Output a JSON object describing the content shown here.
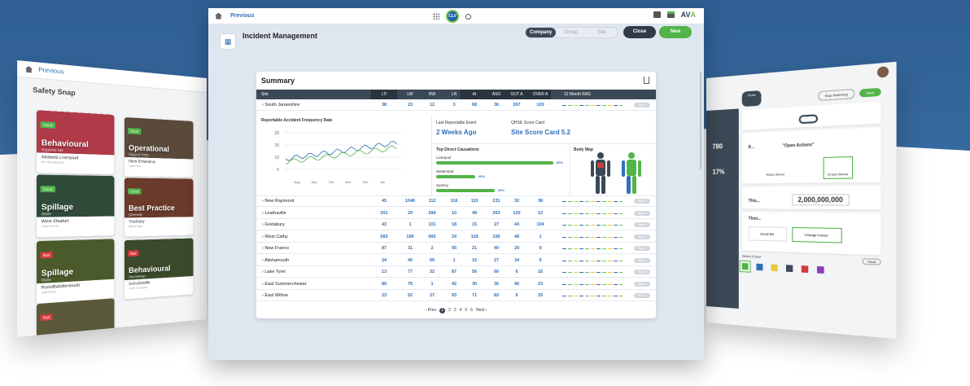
{
  "left_panel": {
    "prev": "Previous",
    "title": "Safety Snap",
    "cards": [
      {
        "tag": "Good",
        "title": "Behavioural",
        "sub": "Organise site",
        "place": "Airaweb Liverpool",
        "meta": "Eric Shaughnessy",
        "color": "#b03a48",
        "tagc": "#52b34a"
      },
      {
        "tag": "Good",
        "title": "Operational",
        "sub": "Support Tools",
        "place": "New Ernestina",
        "meta": "Logan Sixa",
        "color": "#5a4a3a",
        "tagc": "#52b34a"
      },
      {
        "tag": "Good",
        "title": "Spillage",
        "sub": "Water",
        "place": "West Elsafurt",
        "meta": "Fulton Turmul",
        "color": "#2f4a38",
        "tagc": "#52b34a"
      },
      {
        "tag": "Good",
        "title": "Best Practice",
        "sub": "Driveway",
        "place": "Yostbury",
        "meta": "Marcel Rapp",
        "color": "#6a3a2a",
        "tagc": "#52b34a"
      },
      {
        "tag": "Bad",
        "title": "Spillage",
        "sub": "Water",
        "place": "Runolfsdottirmouth",
        "meta": "Leila Mckay",
        "color": "#4a5a2a",
        "tagc": "#d63b3b"
      },
      {
        "tag": "Bad",
        "title": "Behavioural",
        "sub": "Housekeep",
        "place": "Schulistville",
        "meta": "Ulrich Hernandez",
        "color": "#3a4a2a",
        "tagc": "#d63b3b"
      },
      {
        "tag": "Bad",
        "title": "",
        "sub": "",
        "place": "",
        "meta": "",
        "color": "#5a5a3a",
        "tagc": "#d63b3b"
      }
    ]
  },
  "topbar": {
    "previous": "Previous",
    "logo": "CLV",
    "brand_a": "AV",
    "brand_b": "A"
  },
  "page": {
    "title": "Incident Management",
    "seg": [
      "Company",
      "Group",
      "Site"
    ],
    "close": "Close",
    "new": "New"
  },
  "summary": {
    "title": "Summary",
    "headers": [
      "Site",
      "LTI",
      "LW",
      "RW",
      "LR",
      "AI",
      "ASO",
      "OUT A",
      "OVER A",
      "12 Month RAG"
    ],
    "first": {
      "name": "South Janaeshire",
      "vals": [
        "38",
        "23",
        "12",
        "3",
        "68",
        "36",
        "267",
        "103"
      ],
      "report": "Report"
    },
    "chart": {
      "title": "Reportable Accident Frequency Rate",
      "yticks": [
        "20",
        "15",
        "10",
        "5"
      ],
      "xticks": [
        "Aug",
        "Sep",
        "Oct",
        "Nov",
        "Dec",
        "Jan"
      ]
    },
    "last_event_label": "Last Reportable Event",
    "last_event": "2 Weeks Ago",
    "qhse_label": "QHSE Score Card",
    "qhse": "Site Score Card 5.2",
    "causes_label": "Top Direct Causations",
    "causes": [
      {
        "name": "Liverpool",
        "pct": "60%",
        "v": 0.6
      },
      {
        "name": "Walterstad",
        "pct": "20%",
        "v": 0.2
      },
      {
        "name": "Sydney",
        "pct": "30%",
        "v": 0.3
      }
    ],
    "body_map": "Body Map",
    "rows": [
      {
        "name": "New Raymond",
        "vals": [
          "45",
          "1046",
          "112",
          "116",
          "110",
          "231",
          "32",
          "38"
        ]
      },
      {
        "name": "Leathaville",
        "vals": [
          "201",
          "29",
          "284",
          "10",
          "49",
          "263",
          "120",
          "12"
        ]
      },
      {
        "name": "Gretabury",
        "vals": [
          "43",
          "1",
          "101",
          "18",
          "15",
          "27",
          "44",
          "104"
        ]
      },
      {
        "name": "West Cathy",
        "vals": [
          "683",
          "106",
          "965",
          "24",
          "118",
          "106",
          "48",
          "1"
        ]
      },
      {
        "name": "New Franco",
        "vals": [
          "87",
          "31",
          "2",
          "95",
          "21",
          "40",
          "29",
          "9"
        ]
      },
      {
        "name": "Alishamouth",
        "vals": [
          "24",
          "40",
          "65",
          "1",
          "15",
          "27",
          "34",
          "9"
        ]
      },
      {
        "name": "Lake Tyrel",
        "vals": [
          "13",
          "77",
          "32",
          "87",
          "56",
          "60",
          "6",
          "16"
        ]
      },
      {
        "name": "East Summerchester",
        "vals": [
          "85",
          "75",
          "1",
          "42",
          "30",
          "36",
          "40",
          "23"
        ]
      },
      {
        "name": "East Willow",
        "vals": [
          "23",
          "52",
          "27",
          "93",
          "71",
          "83",
          "9",
          "25"
        ]
      }
    ],
    "report": "Report",
    "pager": {
      "prev": "‹ Prev",
      "pages": [
        "1",
        "2",
        "3",
        "4",
        "5",
        "6"
      ],
      "next": "Next ›"
    }
  },
  "right_panel": {
    "close": "Close",
    "stop": "Stop Watching",
    "save": "Save",
    "if": "If...",
    "open": "\"Open Actions\"",
    "rises": "Rises Above",
    "drops": "Drops Below",
    "this": "This...",
    "value": "2,000,000,000",
    "then": "Then...",
    "email": "Email Me",
    "change": "Change Colour",
    "select": "Select Colour",
    "clear": "Clear",
    "k1": "780",
    "k2": "17%",
    "swatches": [
      "#52b34a",
      "#2f6fb8",
      "#e8c93a",
      "#3b4956",
      "#d63b3b",
      "#8a3fb8"
    ]
  }
}
